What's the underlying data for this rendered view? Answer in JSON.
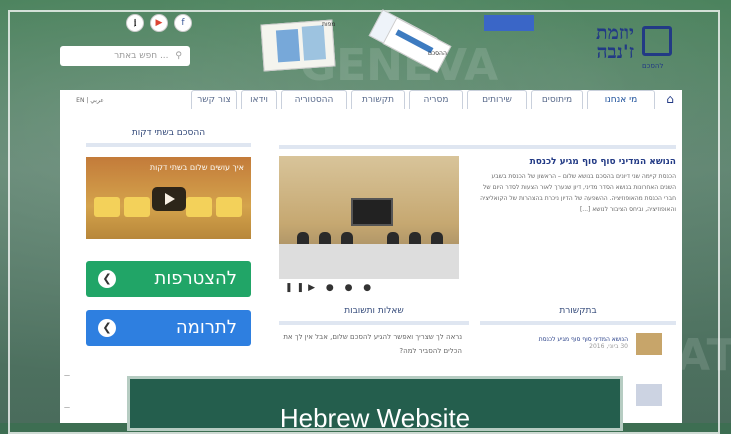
{
  "colors": {
    "accent": "#223a85",
    "join_button": "#21a567",
    "donate_button": "#2e7fe0",
    "overlay": "#245e4d"
  },
  "header": {
    "logo_title": "יוזמת ז'נבה",
    "logo_subtitle": "להסכם",
    "search_placeholder": "חפש באתר ...",
    "social": [
      "twitter-icon",
      "youtube-icon",
      "facebook-icon"
    ],
    "maps_label": "מפות",
    "docs_label": "ההסכם"
  },
  "nav": {
    "home_icon": "home-icon",
    "tabs": [
      "מי אנחנו",
      "מיתוסים",
      "שירותים",
      "מסריה",
      "תקשורת",
      "ההסטוריה",
      "וידאו",
      "צור קשר"
    ],
    "lang": "EN  |  عربي"
  },
  "main": {
    "news_section_title": "",
    "news_title": "הנושא המדיני סוף סוף מגיע לכנסת",
    "news_body": "הכנסת קיימה שני דיונים בהסכם בנושא שלום – הראשון של הכנסת בשבע השנים האחרונות בנושא הסדר מדיני, דיון שנערך לאור הצעות לסדר היום של חברי הכנסת מהאופוזיציה. ההשפעה של הדיון ניכרת בהצהרות של הקואליציה והאופוזיציה, וביחס הציבור לנושא [...]",
    "video_section_title": "ההסכם בשתי דקות",
    "video_caption": "איך עושים שלום בשתי דקות",
    "join_label": "להצטרפות",
    "donate_label": "לתרומה",
    "qa_title": "שאלות ותשובות",
    "qa_text": "נראה לך שצריך ואפשר להגיע להסכם שלום, אבל אין לך את הכלים להסביר למה?",
    "media_title": "בתקשורת",
    "media_items": [
      {
        "title": "הנושא המדיני סוף סוף מגיע לכנסת",
        "date": "30 ביוני, 2016"
      }
    ]
  },
  "overlay": {
    "label": "Hebrew Website"
  }
}
